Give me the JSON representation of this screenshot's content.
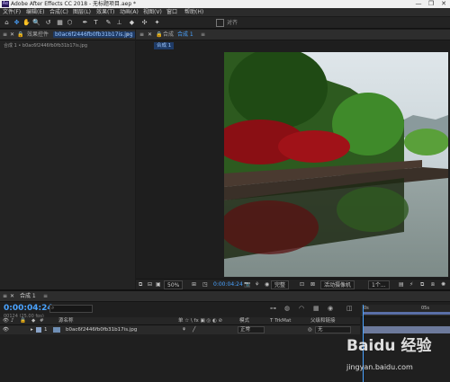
{
  "window": {
    "title": "Adobe After Effects CC 2018 - 无标题项目.aep *",
    "logo": "Ae",
    "controls": [
      "—",
      "❐",
      "✕"
    ]
  },
  "menu": [
    "文件(F)",
    "编辑(E)",
    "合成(C)",
    "图层(L)",
    "效果(T)",
    "动画(A)",
    "视图(V)",
    "窗口",
    "帮助(H)"
  ],
  "toolbar": {
    "tools": [
      "⌂",
      "✥",
      "✋",
      "🔍",
      "↺",
      "▦",
      "⬡",
      "✒",
      "T",
      "✎",
      "⊥",
      "◆",
      "✣",
      "✦"
    ],
    "align_label": "对齐"
  },
  "project_panel": {
    "tab_label": "项目",
    "title_label": "效果控件",
    "file_name": "b0ac6f2446fb0fb31b17is.jpg",
    "subtitle": "合成 1 • b0ac6f2446fb0fb31b17is.jpg"
  },
  "composition_panel": {
    "tab_prefix": "合成",
    "tab_label": "合成 1",
    "breadcrumb": "合成 1"
  },
  "viewer_bar": {
    "zoom": "50%",
    "time": "0:00:04:24",
    "quality": "完整",
    "camera": "活动摄像机",
    "views": "1个..."
  },
  "timeline": {
    "tab_label": "合成 1",
    "current_time": "0:00:04:24",
    "frame_info": "00124 (25.00 fps)",
    "search_icon": "search-icon",
    "columns": {
      "source_name": "源名称",
      "switches": "单 ☆ \\ fx ▣ ◎ ◐ ⊘",
      "mode": "模式",
      "trkmat": "T TrkMat",
      "parent": "父级和链接"
    },
    "layer": {
      "index": "1",
      "name": "b0ac6f2446fb0fb31b17is.jpg",
      "mode": "正常",
      "parent": "无"
    },
    "ruler": {
      "start": "0s",
      "mark": "05s"
    }
  },
  "watermark": {
    "main": "Baidu 经验",
    "sub": "jingyan.baidu.com"
  }
}
